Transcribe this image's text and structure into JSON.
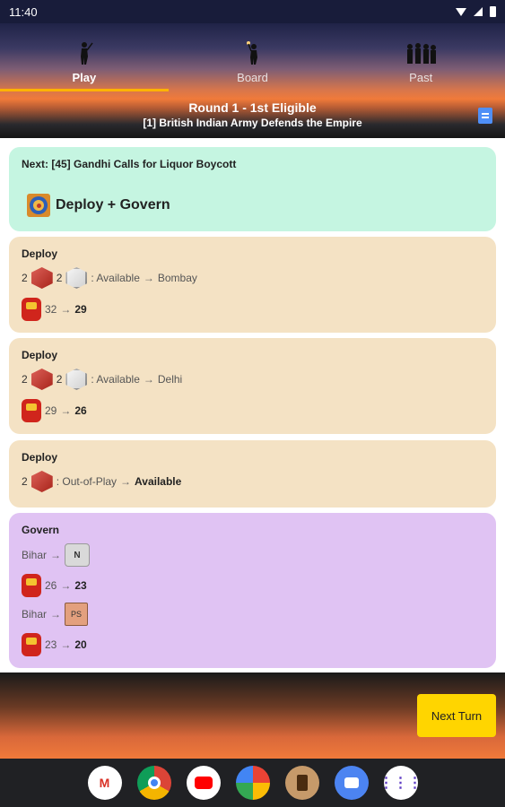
{
  "status_bar": {
    "time": "11:40"
  },
  "tabs": [
    {
      "label": "Play",
      "icon": "soldier-icon"
    },
    {
      "label": "Board",
      "icon": "torch-soldier-icon"
    },
    {
      "label": "Past",
      "icon": "crowd-icon"
    }
  ],
  "round": {
    "title": "Round 1 - 1st Eligible",
    "subtitle": "[1] British Indian Army Defends the Empire"
  },
  "next_card": {
    "label": "Next: [45] Gandhi Calls for Liquor Boycott",
    "action": "Deploy + Govern"
  },
  "deploy_1": {
    "title": "Deploy",
    "red_count": "2",
    "white_count": "2",
    "from": ": Available",
    "arrow": "→",
    "to": "Bombay",
    "resource_from": "32",
    "resource_to": "29"
  },
  "deploy_2": {
    "title": "Deploy",
    "red_count": "2",
    "white_count": "2",
    "from": ": Available",
    "arrow": "→",
    "to": "Delhi",
    "resource_from": "29",
    "resource_to": "26"
  },
  "deploy_3": {
    "title": "Deploy",
    "red_count": "2",
    "from": ": Out-of-Play",
    "arrow": "→",
    "to": "Available"
  },
  "govern": {
    "title": "Govern",
    "place_1": "Bihar",
    "arrow": "→",
    "marker_1": "N",
    "res1_from": "26",
    "res1_to": "23",
    "place_2": "Bihar",
    "marker_2": "PS",
    "res2_from": "23",
    "res2_to": "20"
  },
  "footer": {
    "next_turn": "Next Turn"
  },
  "dock": [
    {
      "name": "Gmail",
      "glyph": "M"
    },
    {
      "name": "Chrome"
    },
    {
      "name": "YouTube"
    },
    {
      "name": "Photos"
    },
    {
      "name": "Game"
    },
    {
      "name": "Messages"
    },
    {
      "name": "Apps",
      "glyph": "⋮⋮⋮"
    }
  ]
}
